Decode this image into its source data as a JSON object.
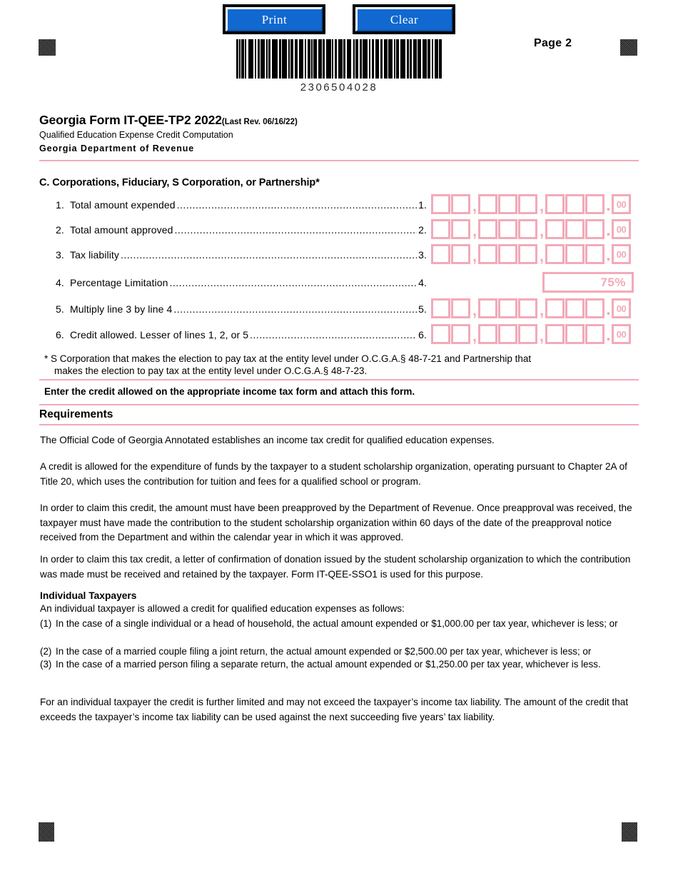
{
  "buttons": {
    "print": "Print",
    "clear": "Clear"
  },
  "barcode": {
    "number": "2306504028",
    "pattern": [
      3,
      1,
      2,
      1,
      3,
      1,
      2,
      3,
      6,
      2,
      2,
      2,
      3,
      1,
      5,
      2,
      2,
      1,
      3,
      2,
      7,
      2,
      3,
      1,
      6,
      2,
      2,
      1,
      4,
      2,
      3,
      2,
      6,
      2,
      2,
      2,
      3,
      1,
      2,
      1,
      5,
      2,
      4,
      1,
      3,
      2,
      6,
      1,
      2,
      2,
      3,
      2,
      5,
      1,
      3,
      2,
      6,
      2,
      2,
      1,
      4,
      2,
      3,
      1,
      6,
      2,
      2,
      2,
      3,
      1,
      5,
      2,
      3,
      2,
      4,
      1,
      6,
      2,
      2,
      1,
      3,
      2,
      7,
      2,
      2,
      1,
      3,
      2,
      5,
      1,
      4,
      2,
      6,
      1,
      3,
      2,
      2,
      2,
      5,
      1,
      3
    ]
  },
  "page_label": "Page 2",
  "header": {
    "title": "Georgia Form IT-QEE-TP2 2022",
    "revision": "(Last Rev. 06/16/22)",
    "subtitle": "Qualified Education Expense Credit Computation",
    "agency": "Georgia Department of Revenue"
  },
  "section_c": {
    "title": "C.  Corporations, Fiduciary, S Corporation, or Partnership*",
    "lines": [
      {
        "number": "1.",
        "text": "Total amount expended",
        "ref": "1."
      },
      {
        "number": "2.",
        "text": "Total amount approved",
        "ref": "2."
      },
      {
        "number": "3.",
        "text": "Tax liability",
        "ref": "3."
      },
      {
        "number": "4.",
        "text": "Percentage Limitation",
        "ref": "4."
      },
      {
        "number": "5.",
        "text": "Multiply line 3 by line 4",
        "ref": "5."
      },
      {
        "number": "6.",
        "text": "Credit allowed. Lesser of lines 1, 2, or 5",
        "ref": "6."
      }
    ],
    "dots": "..............................................................................................................................",
    "cents_value": "00",
    "percentage_limitation_value": "75%",
    "money_field_layout": "2 digits, comma, 3 digits, comma, 3 digits, decimal, cents"
  },
  "footnote": {
    "line1": "* S Corporation that makes the election to pay tax at the entity level under  O.C.G.A.§ 48-7-21 and Partnership that",
    "line2": "makes the election to pay tax at the entity level under O.C.G.A.§ 48-7-23."
  },
  "enter_credit_note": "Enter the credit allowed on the appropriate income tax form and attach this form.",
  "requirements": {
    "title": "Requirements",
    "paragraphs": [
      "The Official Code of Georgia Annotated establishes an income tax credit for qualified education expenses.",
      "A credit is allowed for the expenditure of funds by the taxpayer to a student scholarship organization, operating pursuant to Chapter 2A of Title 20, which uses the contribution for tuition and fees for a qualified school or program.",
      "In order to claim this credit, the amount must have been preapproved by the Department of Revenue.  Once preapproval was received, the taxpayer must have made the contribution to the student scholarship organization within 60 days of the date of the preapproval notice received from the Department and within the calendar year in which it was approved.",
      "In order to claim this tax credit, a letter of confirmation of donation issued by the student scholarship organization to which the contribution was made must be received and retained by the taxpayer. Form IT-QEE-SSO1 is used for this purpose."
    ]
  },
  "individual_taxpayers": {
    "heading": "Individual Taxpayers",
    "intro": "An individual taxpayer is allowed a credit for qualified education expenses as follows:",
    "items": [
      {
        "mark": "(1)",
        "text": "In the case of a single individual or a head of household, the actual amount expended or $1,000.00 per tax year, whichever is less; or"
      },
      {
        "mark": "(2)",
        "text": "In the case of a married couple filing a joint return, the actual amount expended or $2,500.00 per tax year, whichever is less; or"
      },
      {
        "mark": "(3)",
        "text": "In the case of a married person filing a separate return, the actual amount expended or $1,250.00 per tax year, whichever is less."
      }
    ],
    "closing": "For an individual taxpayer the credit is further limited and may not exceed the taxpayer’s income tax liability. The amount of the credit that exceeds the taxpayer’s income tax liability can be used against the next succeeding five years’ tax liability."
  },
  "colors": {
    "field_pink": "#f2aab9",
    "button_blue": "#1068d0",
    "text_black": "#000000"
  }
}
